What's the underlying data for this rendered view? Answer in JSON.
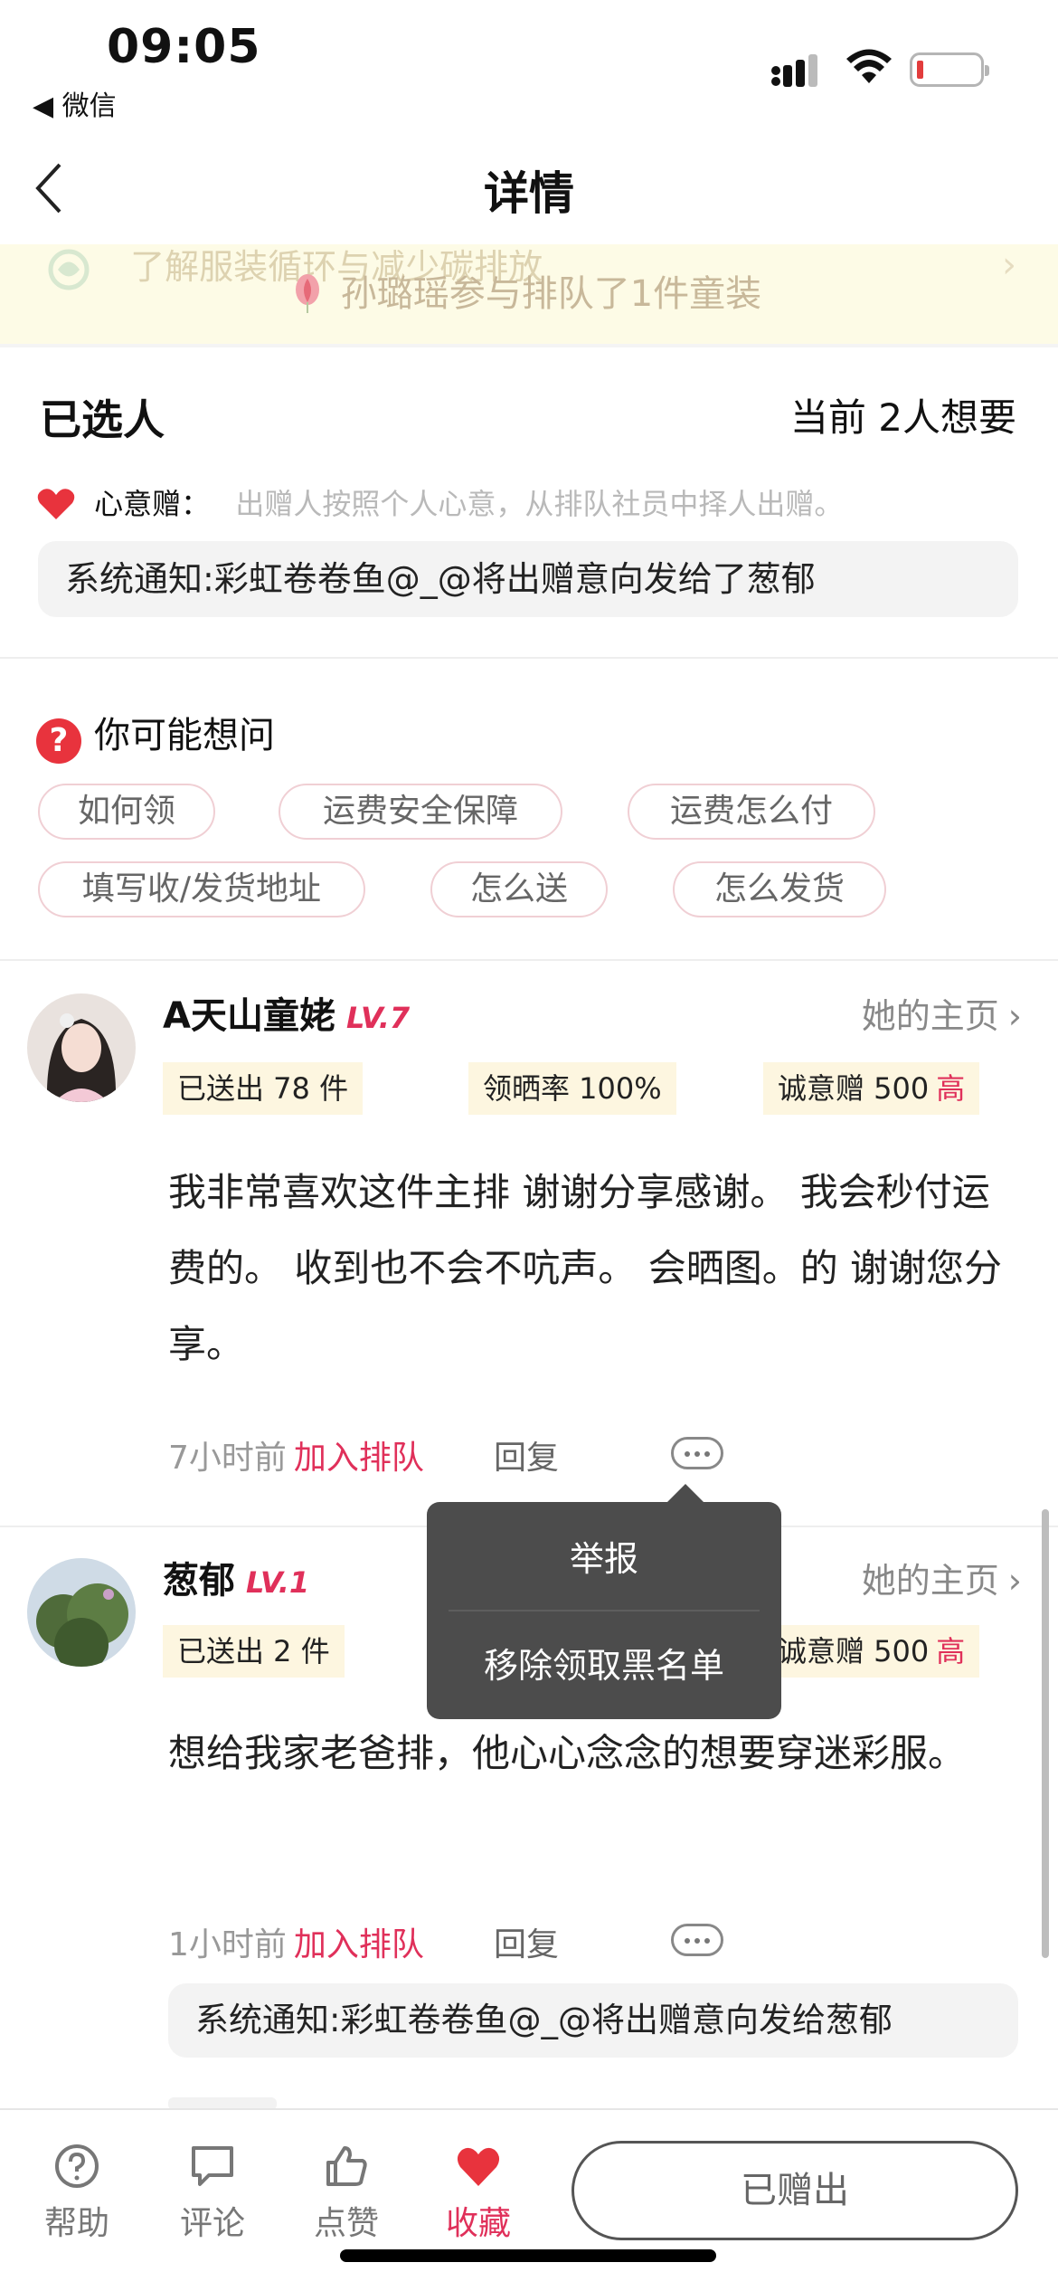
{
  "status": {
    "time": "09:05",
    "back_app": "◀ 微信"
  },
  "nav": {
    "title": "详情"
  },
  "banner": {
    "faded_text": "了解服装循环与减少碳排放",
    "main_text": "孙璐瑶参与排队了1件童装"
  },
  "selected": {
    "title": "已选人",
    "count": "当前 2人想要",
    "gift_label": "心意赠：",
    "gift_desc": "出赠人按照个人心意，从排队社员中择人出赠。",
    "notice": "系统通知:彩虹卷卷鱼@_@将出赠意向发给了葱郁"
  },
  "faq": {
    "title": "你可能想问",
    "chips": [
      "如何领",
      "运费安全保障",
      "运费怎么付",
      "填写收/发货地址",
      "怎么送",
      "怎么发货"
    ]
  },
  "comments": [
    {
      "name": "A天山童姥",
      "level": "LV.7",
      "home": "她的主页",
      "tags": [
        "已送出 78 件",
        "领晒率 100%",
        "诚意赠 500"
      ],
      "badge": "高",
      "text": "我非常喜欢这件主排 谢谢分享感谢。 我会秒付运费的。 收到也不会不吭声。 会晒图。的 谢谢您分享。",
      "time": "7小时前",
      "join": "加入排队",
      "reply": "回复"
    },
    {
      "name": "葱郁",
      "level": "LV.1",
      "home": "她的主页",
      "tags": [
        "已送出 2 件",
        "诚意赠 500"
      ],
      "badge": "高",
      "text": "想给我家老爸排，他心心念念的想要穿迷彩服。",
      "time": "1小时前",
      "join": "加入排队",
      "reply": "回复",
      "notice": "系统通知:彩虹卷卷鱼@_@将出赠意向发给葱郁"
    }
  ],
  "popup": {
    "items": [
      "举报",
      "移除领取黑名单"
    ]
  },
  "bottom": {
    "tabs": [
      "帮助",
      "评论",
      "点赞",
      "收藏"
    ],
    "given": "已赠出"
  },
  "colors": {
    "accent": "#e0305a",
    "banner_bg": "#fdfbe6",
    "tag_bg": "#fdf6e0"
  }
}
